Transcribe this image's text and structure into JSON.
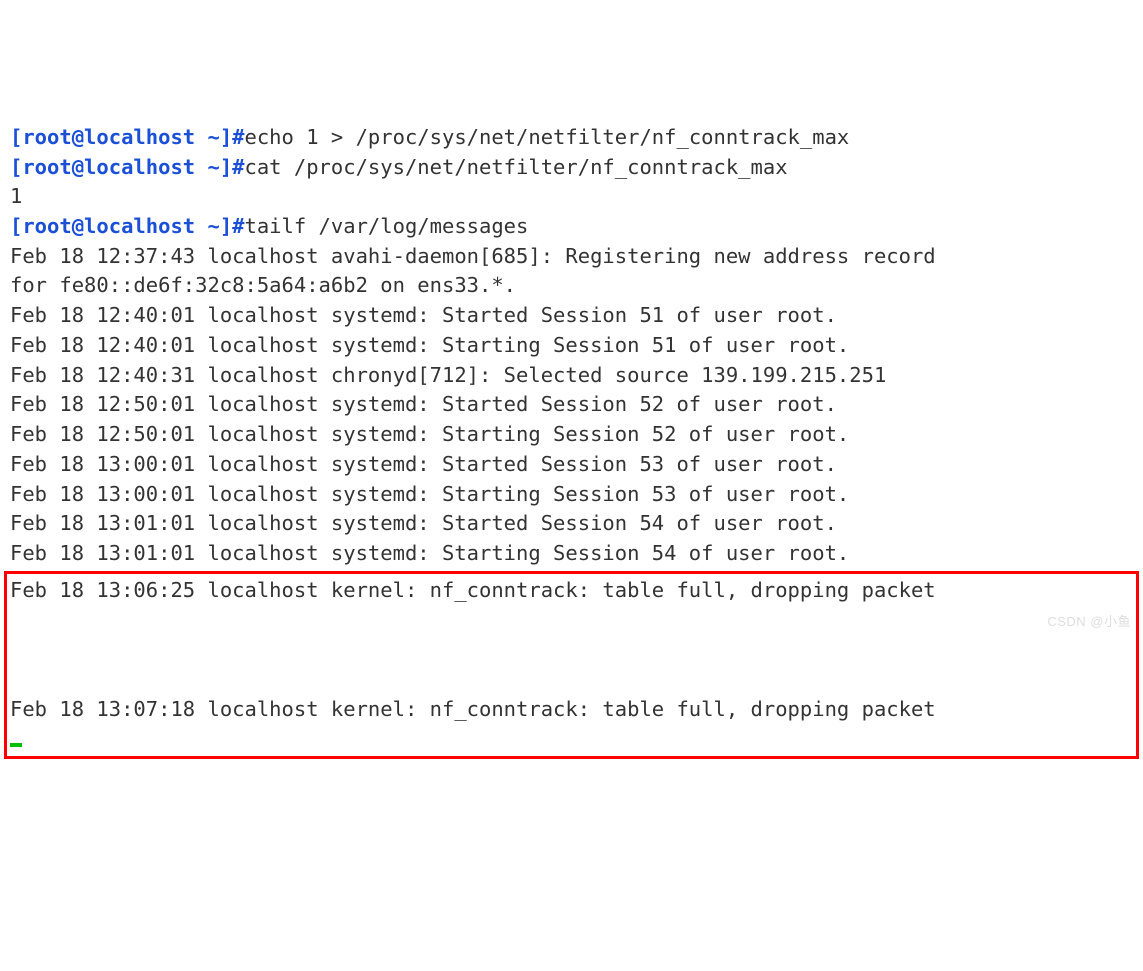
{
  "prompt1": {
    "ps1": "[root@localhost ~]#",
    "cmd": "echo 1 > /proc/sys/net/netfilter/nf_conntrack_max"
  },
  "prompt2": {
    "ps1": "[root@localhost ~]#",
    "cmd": "cat /proc/sys/net/netfilter/nf_conntrack_max"
  },
  "cat_output": "1",
  "prompt3": {
    "ps1": "[root@localhost ~]#",
    "cmd": "tailf /var/log/messages"
  },
  "log_lines": [
    "Feb 18 12:37:43 localhost avahi-daemon[685]: Registering new address record",
    "for fe80::de6f:32c8:5a64:a6b2 on ens33.*.",
    "Feb 18 12:40:01 localhost systemd: Started Session 51 of user root.",
    "Feb 18 12:40:01 localhost systemd: Starting Session 51 of user root.",
    "Feb 18 12:40:31 localhost chronyd[712]: Selected source 139.199.215.251",
    "Feb 18 12:50:01 localhost systemd: Started Session 52 of user root.",
    "Feb 18 12:50:01 localhost systemd: Starting Session 52 of user root.",
    "Feb 18 13:00:01 localhost systemd: Started Session 53 of user root.",
    "Feb 18 13:00:01 localhost systemd: Starting Session 53 of user root.",
    "Feb 18 13:01:01 localhost systemd: Started Session 54 of user root.",
    "Feb 18 13:01:01 localhost systemd: Starting Session 54 of user root."
  ],
  "highlighted_lines": [
    "Feb 18 13:06:25 localhost kernel: nf_conntrack: table full, dropping packet",
    "",
    "",
    "",
    "Feb 18 13:07:18 localhost kernel: nf_conntrack: table full, dropping packet"
  ],
  "watermark": "CSDN @小鱼"
}
